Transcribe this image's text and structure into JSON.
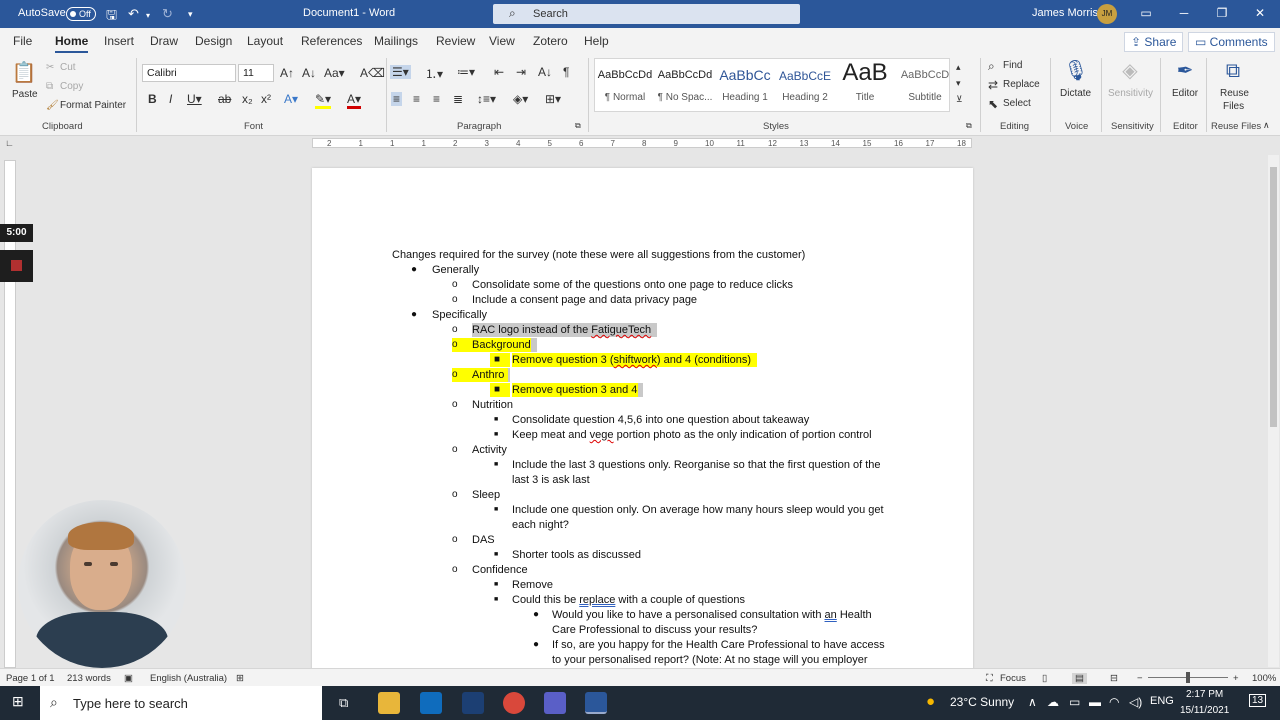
{
  "titlebar": {
    "autosave_label": "AutoSave",
    "autosave_state": "Off",
    "doc_title": "Document1 - Word",
    "search_placeholder": "Search",
    "user_name": "James Morris",
    "user_initials": "JM"
  },
  "tabs": [
    "File",
    "Home",
    "Insert",
    "Draw",
    "Design",
    "Layout",
    "References",
    "Mailings",
    "Review",
    "View",
    "Zotero",
    "Help"
  ],
  "share_label": "Share",
  "comments_label": "Comments",
  "clipboard": {
    "paste": "Paste",
    "cut": "Cut",
    "copy": "Copy",
    "format_painter": "Format Painter",
    "label": "Clipboard"
  },
  "font": {
    "name": "Calibri",
    "size": "11",
    "label": "Font"
  },
  "paragraph": {
    "label": "Paragraph"
  },
  "styles": {
    "items": [
      {
        "preview": "AaBbCcDd",
        "name": "¶ Normal"
      },
      {
        "preview": "AaBbCcDd",
        "name": "¶ No Spac..."
      },
      {
        "preview": "AaBbCc",
        "name": "Heading 1"
      },
      {
        "preview": "AaBbCcE",
        "name": "Heading 2"
      },
      {
        "preview": "AaB",
        "name": "Title"
      },
      {
        "preview": "AaBbCcD",
        "name": "Subtitle"
      }
    ],
    "label": "Styles"
  },
  "editing": {
    "find": "Find",
    "replace": "Replace",
    "select": "Select",
    "label": "Editing"
  },
  "voice": {
    "dictate": "Dictate",
    "label": "Voice"
  },
  "sensitivity": {
    "btn": "Sensitivity",
    "label": "Sensitivity"
  },
  "editor": {
    "btn": "Editor",
    "label": "Editor"
  },
  "reuse": {
    "btn1": "Reuse",
    "btn2": "Files",
    "label": "Reuse Files"
  },
  "recorder": {
    "time": "5:00"
  },
  "doc": {
    "line1": "Changes required for the survey (note these were all suggestions from the customer)",
    "generally": "Generally",
    "g1": "Consolidate some of the questions onto one page to reduce clicks",
    "g2": "Include a consent page and data privacy page",
    "specifically": "Specifically",
    "s1a": "RAC logo instead of the ",
    "s1b": "FatigueTech",
    "background": "Background",
    "bg1a": "Remove question 3 (",
    "bg1b": "shiftwork",
    "bg1c": ") and 4 (conditions)",
    "anthro": "Anthro",
    "an1": "Remove question 3 and 4",
    "nutrition": "Nutrition",
    "n1": "Consolidate question 4,5,6 into one question about takeaway",
    "n2a": "Keep meat and ",
    "n2b": "vege",
    "n2c": " portion photo as the only indication of portion control",
    "activity": "Activity",
    "ac1a": "Include the last 3 questions only. Reorganise so that the first question of the",
    "ac1b": "last 3 is ask last",
    "sleep": "Sleep",
    "sl1a": "Include one question only. On average how many hours sleep would you get",
    "sl1b": "each night?",
    "das": "DAS",
    "das1": "Shorter tools as discussed",
    "confidence": "Confidence",
    "c1": "Remove",
    "c2a": "Could this be ",
    "c2b": "replace",
    "c2c": " with a couple of questions",
    "c3a": "Would you like to have a personalised consultation with ",
    "c3b": "an",
    "c3c": " Health",
    "c3d": "Care Professional to discuss your results?",
    "c4a": "If so, are you happy for the Health Care Professional to have access",
    "c4b": "to your personalised report? (Note: At no stage will you employer"
  },
  "status": {
    "page": "Page 1 of 1",
    "words": "213 words",
    "lang": "English (Australia)",
    "focus": "Focus",
    "zoom": "100%"
  },
  "taskbar": {
    "search": "Type here to search",
    "weather": "23°C  Sunny",
    "lang": "ENG",
    "time": "2:17 PM",
    "date": "15/11/2021",
    "notif": "13"
  },
  "ruler_marks": [
    "2",
    "1",
    "1",
    "1",
    "2",
    "3",
    "4",
    "5",
    "6",
    "7",
    "8",
    "9",
    "10",
    "11",
    "12",
    "13",
    "14",
    "15",
    "16",
    "17",
    "18"
  ]
}
